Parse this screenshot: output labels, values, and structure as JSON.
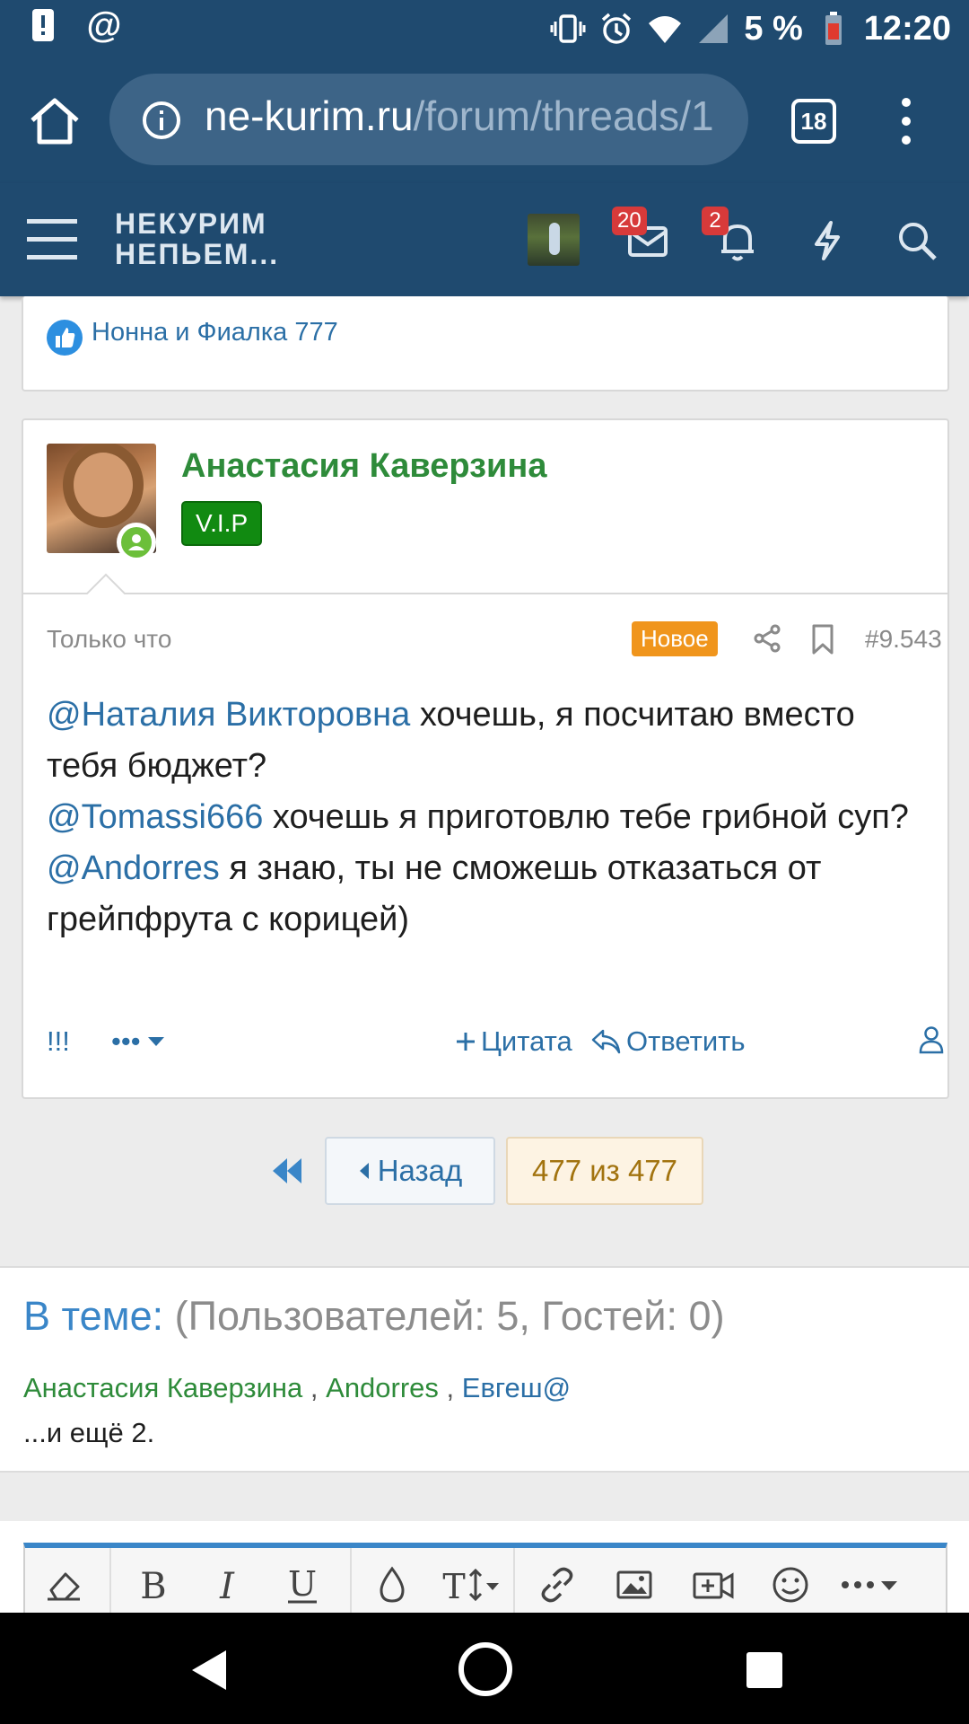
{
  "status_bar": {
    "battery": "5 %",
    "time": "12:20"
  },
  "browser": {
    "url_host": "ne-kurim.ru",
    "url_path": "/forum/threads/1",
    "tab_count": "18"
  },
  "site_header": {
    "logo_line1": "НЕКУРИМ",
    "logo_line2": "НЕПЬЕМ...",
    "messages_badge": "20",
    "alerts_badge": "2"
  },
  "prev_post": {
    "likes_text": "Нонна и Фиалка 777"
  },
  "post": {
    "author": "Анастасия Каверзина",
    "role_badge": "V.I.P",
    "time": "Только что",
    "new_badge": "Новое",
    "number": "#9.543",
    "body": [
      {
        "mention": "@Наталия Викторовна",
        "text": " хочешь, я посчитаю вместо тебя бюджет?"
      },
      {
        "mention": "@Tomassi666",
        "text": " хочешь я приготовлю тебе грибной суп?"
      },
      {
        "mention": "@Andorres",
        "text": " я знаю, ты не сможешь отказаться от грейпфрута с корицей)"
      }
    ],
    "actions": {
      "report": "!!!",
      "more": "•••",
      "quote": "Цитата",
      "reply": "Ответить"
    }
  },
  "pagination": {
    "back_label": "Назад",
    "page_info": "477 из 477"
  },
  "online": {
    "title_label": "В теме:",
    "title_stats": "(Пользователей: 5, Гостей: 0)",
    "users": [
      "Анастасия Каверзина",
      "Andorres",
      "Евгеш@"
    ],
    "separator": " , ",
    "more": "...и ещё 2."
  },
  "colors": {
    "header_bg": "#1f4a6f",
    "link_blue": "#2b6fa6",
    "author_green": "#2e8b3a",
    "vip_green": "#118a11",
    "new_orange": "#f0951c",
    "badge_red": "#d73a3a"
  }
}
